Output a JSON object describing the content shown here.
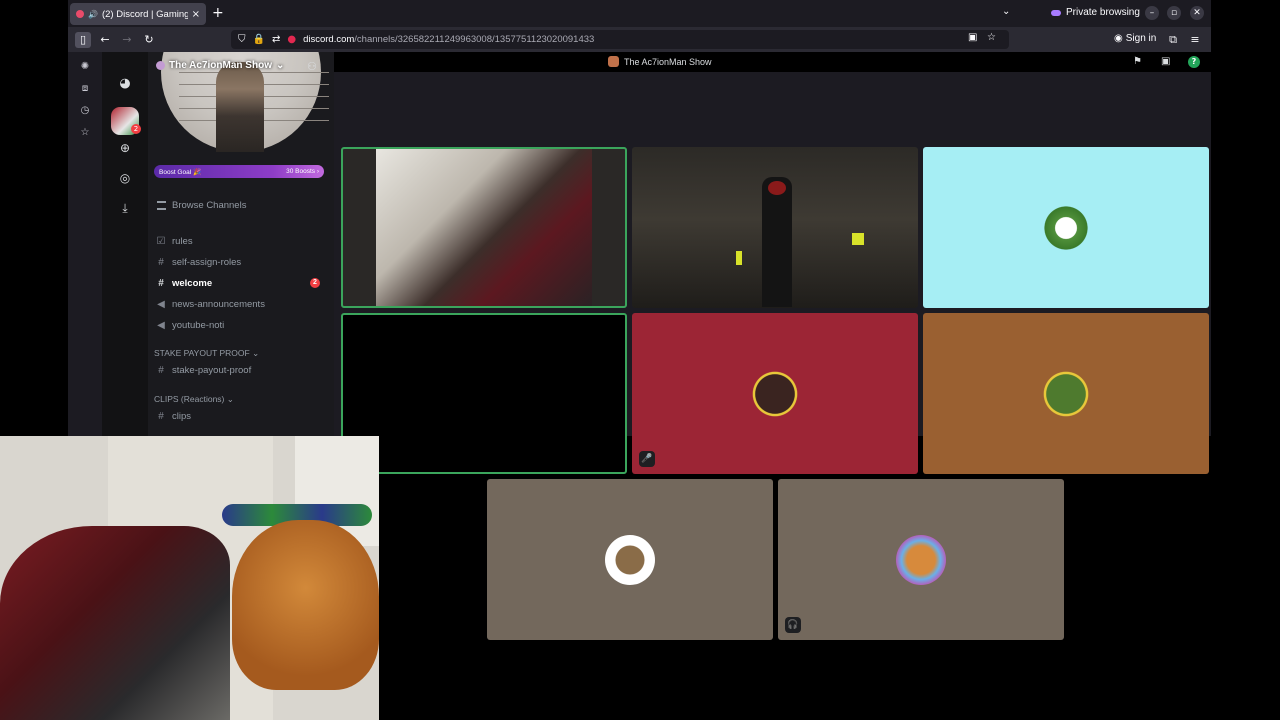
{
  "browser": {
    "tab_title": "(2) Discord | Gaming |",
    "new_tab": "+",
    "private_label": "Private browsing",
    "url_domain": "discord.com",
    "url_path": "/channels/326582211249963008/1357751123020091433",
    "sign_in": "Sign in",
    "window_min": "–",
    "window_max": "▫",
    "window_close": "✕"
  },
  "discord": {
    "server_name": "The Ac7ionMan Show",
    "server_badge": "2",
    "boost_goal": "Boost Goal 🎉",
    "boost_count": "30 Boosts ›",
    "browse_channels": "Browse Channels",
    "channels_top": [
      {
        "glyph": "☑",
        "name": "rules",
        "active": false
      },
      {
        "glyph": "#",
        "name": "self-assign-roles",
        "active": false
      },
      {
        "glyph": "#",
        "name": "welcome",
        "active": true,
        "badge": "2"
      },
      {
        "glyph": "◀",
        "name": "news-announcements",
        "active": false
      },
      {
        "glyph": "◀",
        "name": "youtube-noti",
        "active": false
      }
    ],
    "category_1": "STAKE PAYOUT PROOF ⌄",
    "channel_stake": "stake-payout-proof",
    "category_2": "CLIPS (Reactions) ⌄",
    "channel_clips": "clips",
    "call_title": "The Ac7ionMan Show"
  },
  "colors": {
    "tile_cyan": "#a6eef4",
    "tile_red": "#9c2535",
    "tile_orange": "#9a6031",
    "tile_taupe": "#73685c",
    "speaking": "#3ba55c"
  }
}
